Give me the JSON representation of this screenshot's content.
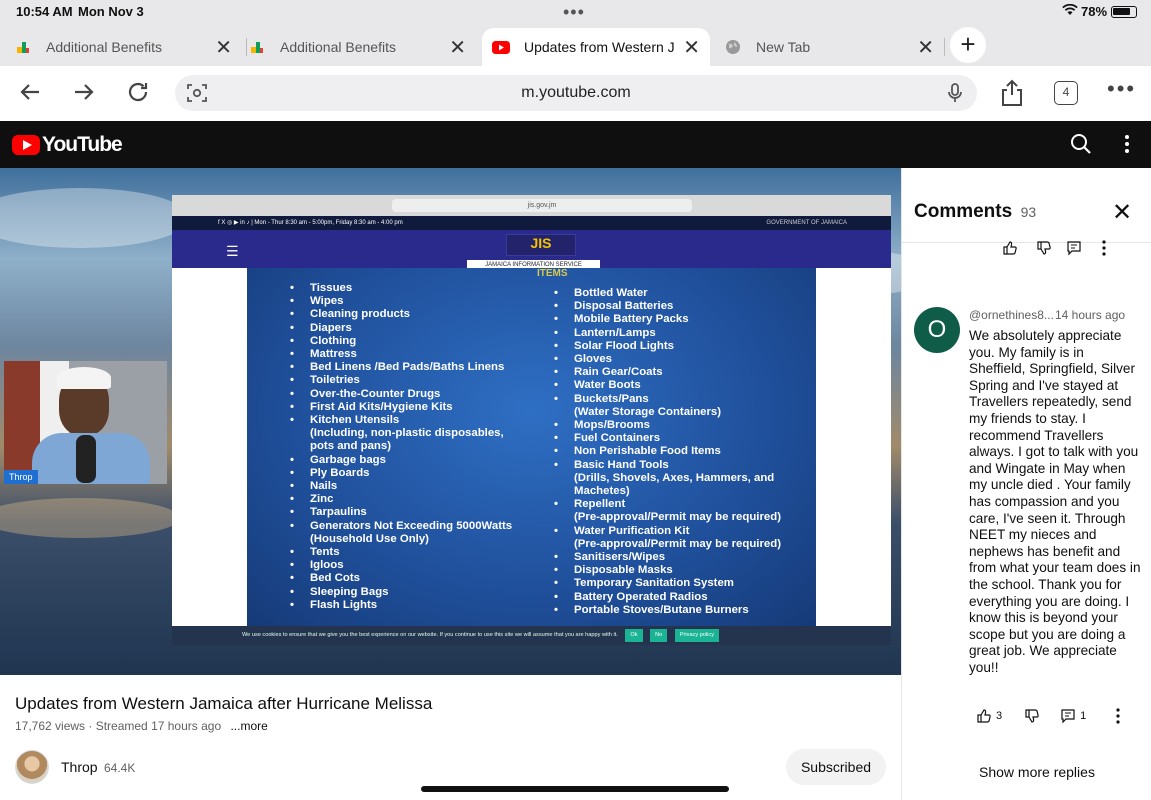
{
  "status": {
    "time": "10:54 AM",
    "date": "Mon Nov 3",
    "battery": "78%"
  },
  "tabs": [
    {
      "label": "Additional Benefits"
    },
    {
      "label": "Additional Benefits"
    },
    {
      "label": "Updates from Western J"
    },
    {
      "label": "New Tab"
    }
  ],
  "tab_count": "4",
  "address": {
    "url": "m.youtube.com"
  },
  "youtube": {
    "logo_text": "YouTube"
  },
  "video": {
    "title": "Updates from Western Jamaica after Hurricane Melissa",
    "meta": "17,762 views · Streamed 17 hours ago",
    "more": "...more",
    "channel": "Throp",
    "subscribers": "64.4K",
    "subscribe_label": "Subscribed",
    "cam_label": "Throp"
  },
  "screen_content": {
    "browser_url": "jis.gov.jm",
    "topbar_text": "f  X  ◎  ▶  in  ♪  |  Mon - Thur 8:30 am - 5:00pm, Friday 8:30 am - 4:00 pm",
    "gov_text": "GOVERNMENT OF JAMAICA",
    "jis_label": "JAMAICA INFORMATION SERVICE",
    "items_title": "ITEMS",
    "col1": [
      "Tissues",
      "Wipes",
      "Cleaning products",
      "Diapers",
      "Clothing",
      "Mattress",
      "Bed Linens /Bed Pads/Baths Linens",
      "Toiletries",
      "Over-the-Counter Drugs",
      "First Aid Kits/Hygiene Kits",
      "Kitchen Utensils",
      "(Including, non-plastic disposables,",
      "pots and pans)",
      "Garbage bags",
      "Ply Boards",
      "Nails",
      "Zinc",
      "Tarpaulins",
      "Generators Not Exceeding 5000Watts",
      "(Household Use Only)",
      "Tents",
      "Igloos",
      "Bed Cots",
      "Sleeping Bags",
      "Flash Lights"
    ],
    "col2": [
      "Bottled Water",
      "Disposal Batteries",
      "Mobile Battery Packs",
      "Lantern/Lamps",
      "Solar Flood Lights",
      "Gloves",
      "Rain Gear/Coats",
      "Water Boots",
      "Buckets/Pans",
      "(Water Storage Containers)",
      "Mops/Brooms",
      "Fuel Containers",
      "Non Perishable Food Items",
      "Basic Hand Tools",
      "(Drills, Shovels, Axes, Hammers, and",
      "Machetes)",
      "Repellent",
      "(Pre-approval/Permit may be required)",
      "Water Purification Kit",
      "(Pre-approval/Permit may be required)",
      "Sanitisers/Wipes",
      "Disposable Masks",
      "Temporary Sanitation System",
      "Battery Operated Radios",
      "Portable Stoves/Butane Burners"
    ],
    "cookie_text": "We use cookies to ensure that we give you the best experience on our website. If you continue to use this site we will assume that you are happy with it.",
    "cookie_ok": "Ok",
    "cookie_no": "No",
    "cookie_privacy": "Privacy policy"
  },
  "comments": {
    "title": "Comments",
    "count": "93",
    "comment": {
      "avatar_letter": "O",
      "author": "@ornethines8...",
      "time": "14 hours ago",
      "text": "We absolutely appreciate you. My family is in Sheffield,  Springfield, Silver Spring and I've stayed at Travellers repeatedly, send my friends to stay. I recommend Travellers always. I got to talk with you and Wingate in May when my uncle died . Your family has compassion and you care, I've seen it. Through NEET my nieces and nephews has benefit and from what your team does in the school. Thank you for everything you are doing. I know this is beyond your scope but you are doing a great job.  We appreciate you!!",
      "likes": "3",
      "replies": "1"
    },
    "show_more": "Show more replies"
  }
}
